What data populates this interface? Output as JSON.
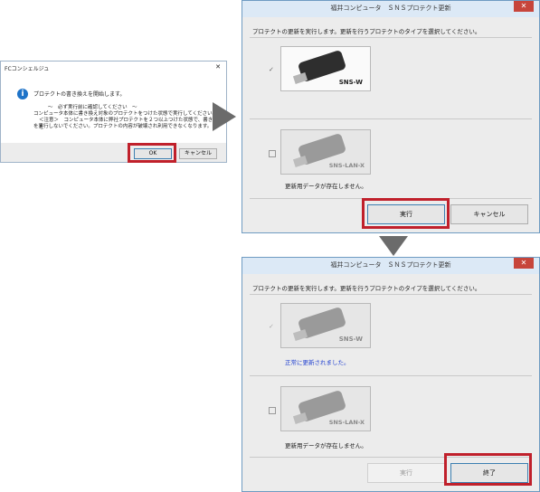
{
  "dialog1": {
    "title": "FCコンシェルジュ",
    "close": "✕",
    "message": "プロテクトの書き換えを開始します。",
    "lines": [
      "〜　必ず実行前に確認してください　〜",
      "コンピュータ本体に書き換え対象のプロテクトをつけた状態で実行してください。",
      "＜注意＞　コンピュータ本体に弊社プロテクトを２つ以上つけた状態で、書き換えを",
      "を実行しないでください。プロテクトの内容が破壊され利用できなくなります。"
    ],
    "ok_label": "OK",
    "cancel_label": "キャンセル"
  },
  "dialog2": {
    "title": "福井コンピュータ　ＳＮＳプロテクト更新",
    "close": "✕",
    "instruction": "プロテクトの更新を実行します。更新を行うプロテクトのタイプを選択してください。",
    "protect1": {
      "label": "SNS-W",
      "checked": "✓"
    },
    "protect2": {
      "label": "SNS-LAN-X",
      "checked": "",
      "status": "更新用データが存在しません。"
    },
    "run_label": "実行",
    "cancel_label": "キャンセル"
  },
  "dialog3": {
    "title": "福井コンピュータ　ＳＮＳプロテクト更新",
    "close": "✕",
    "instruction": "プロテクトの更新を実行します。更新を行うプロテクトのタイプを選択してください。",
    "protect1": {
      "label": "SNS-W",
      "checked": "✓",
      "status": "正常に更新されました。"
    },
    "protect2": {
      "label": "SNS-LAN-X",
      "checked": "",
      "status": "更新用データが存在しません。"
    },
    "run_label": "実行",
    "end_label": "終了"
  },
  "colors": {
    "highlight": "#c0202b",
    "arrow": "#6b6b6b",
    "success_text": "#1f3fd0"
  }
}
